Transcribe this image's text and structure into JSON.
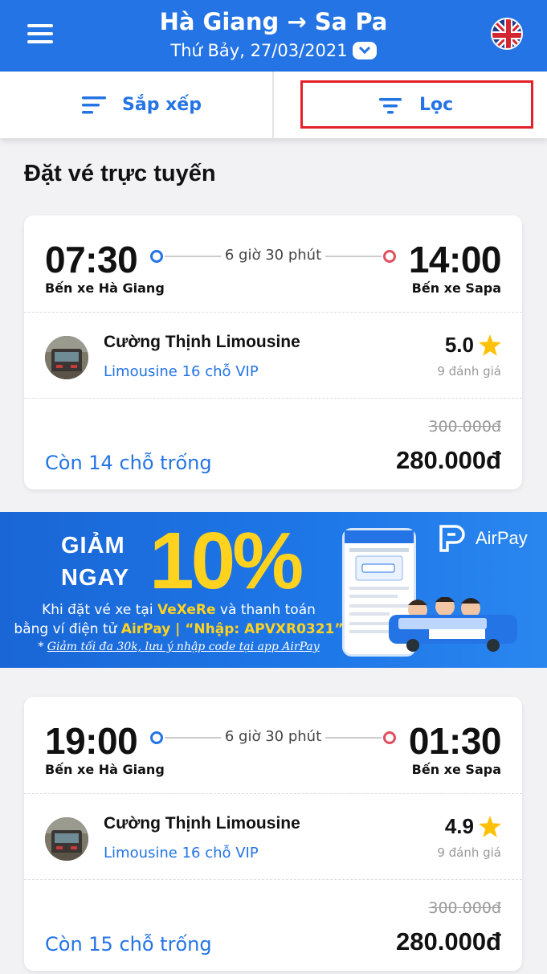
{
  "header": {
    "from": "Hà Giang",
    "arrow": "→",
    "to": "Sa Pa",
    "date": "Thứ Bảy, 27/03/2021"
  },
  "toolbar": {
    "sort_label": "Sắp xếp",
    "filter_label": "Lọc"
  },
  "section_title": "Đặt vé trực tuyến",
  "trips": [
    {
      "depart_time": "07:30",
      "arrive_time": "14:00",
      "duration": "6 giờ 30 phút",
      "depart_station": "Bến xe Hà Giang",
      "arrive_station": "Bến xe Sapa",
      "operator": "Cường Thịnh Limousine",
      "bus_type": "Limousine 16 chỗ VIP",
      "rating": "5.0",
      "reviews": "9 đánh giá",
      "old_price": "300.000đ",
      "seats": "Còn 14 chỗ trống",
      "price": "280.000đ"
    },
    {
      "depart_time": "19:00",
      "arrive_time": "01:30",
      "duration": "6 giờ 30 phút",
      "depart_station": "Bến xe Hà Giang",
      "arrive_station": "Bến xe Sapa",
      "operator": "Cường Thịnh Limousine",
      "bus_type": "Limousine 16 chỗ VIP",
      "rating": "4.9",
      "reviews": "9 đánh giá",
      "old_price": "300.000đ",
      "seats": "Còn 15 chỗ trống",
      "price": "280.000đ"
    }
  ],
  "banner": {
    "giam": "GIẢM",
    "ngay": "NGAY",
    "percent": "10%",
    "line1_prefix": "Khi đặt vé xe tại ",
    "line1_brand": "VeXeRe",
    "line1_suffix": " và thanh toán",
    "line2_prefix": "bằng ví điện tử ",
    "line2_highlight": "AirPay | “Nhập: APVXR0321”",
    "note_star": "* ",
    "note": "Giảm tối đa 30k, lưu ý nhập code tại app AirPay",
    "airpay": "AirPay",
    "van_brand": "vexere"
  },
  "colors": {
    "primary": "#2474e5",
    "highlight_box": "#e5202a",
    "star": "#ffc107",
    "arrive_dot": "#e04f5f",
    "banner_yellow": "#ffd21f"
  }
}
